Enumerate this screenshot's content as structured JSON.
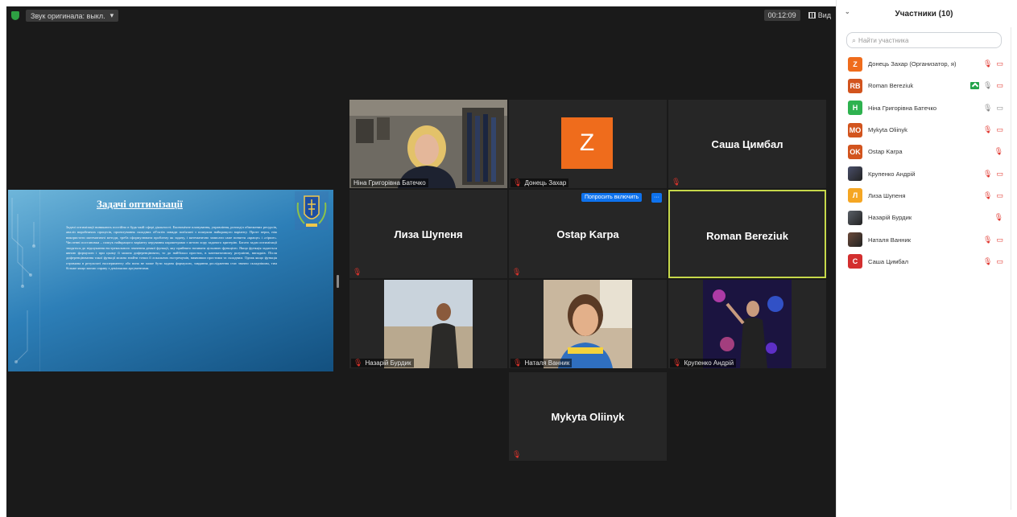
{
  "topbar": {
    "audio_label": "Звук оригинала: выкл.",
    "audio_caret": "▾",
    "timer": "00:12:09",
    "view_label": "Вид"
  },
  "share": {
    "title": "Задачі оптимізації",
    "body": "Задачі оптимізації виникають постійно в будь-якій сфері діяльності. Економічне планування, управління, розподіл обмежених ресурсів, аналіз виробничих процесів, проектування складних об'єктів завжди пов'язані з пошуком найкращого варіанту. Проте перш, ніж використати математичні методи, треба сформулювати проблему як задачу, і математично записати саме поняття «краще» і «гірше». Численні постановки – пошук найкращого варіанту керування параметрами з метою хору заданого критерію. Багато задач оптимізації зводяться до відшукання екстремального значення деякої функції, яку прийнято називати цільовою функцією. Якщо функція задається явною формулою і при цьому її можна диференціювати, то до найбільш простих, в математичному розумінні, випадків. Після диференціювання такої функції можна знайти точки її локальних екстремумів, виявивши простими та складним. Однак якщо функція отримана в результаті експерименту або вона не може бути задана формулою, завдання дослідження стає значно складнішим, тим більше якщо маємо справу з декількома аргументами."
  },
  "tiles": {
    "nina": "Ніна Григорівна Батечко",
    "donets_avatar": "Z",
    "donets": "Донець Захар",
    "sasha": "Саша Цимбал",
    "liza": "Лиза Шупеня",
    "ostap": "Ostap Karpa",
    "roman": "Roman Bereziuk",
    "nazariy": "Назарій Бурдик",
    "natalia": "Наталя Ванник",
    "krupenko": "Крупенко Андрій",
    "mykyta": "Mykyta Oliinyk",
    "ask_unmute": "Попросить включить",
    "more": "···"
  },
  "panel": {
    "title": "Участники (10)",
    "search_placeholder": "Найти участника",
    "participants": [
      {
        "initials": "Z",
        "color": "#ef6c1c",
        "name": "Донець Захар (Организатор, я)",
        "icons": "mic-off video-off"
      },
      {
        "initials": "RB",
        "color": "#d2541e",
        "name": "Roman Bereziuk",
        "icons": "share mic video-off"
      },
      {
        "initials": "H",
        "color": "#2eb24f",
        "name": "Ніна Григорівна Батечко",
        "icons": "mic-on video-on"
      },
      {
        "initials": "MO",
        "color": "#d2541e",
        "name": "Mykyta Oliinyk",
        "icons": "mic-off video-off"
      },
      {
        "initials": "OK",
        "color": "#d2541e",
        "name": "Ostap Karpa",
        "icons": "mic-off"
      },
      {
        "initials": "",
        "color": "#4a4f6a",
        "name": "Крупенко Андрій",
        "icons": "mic-off video-off"
      },
      {
        "initials": "Л",
        "color": "#f5a623",
        "name": "Лиза Шупеня",
        "icons": "mic-off video-off"
      },
      {
        "initials": "",
        "color": "#5a6068",
        "name": "Назарій Бурдик",
        "icons": "mic-off"
      },
      {
        "initials": "",
        "color": "#6b4a3a",
        "name": "Наталя Ванник",
        "icons": "mic-off video-off"
      },
      {
        "initials": "C",
        "color": "#d32f2f",
        "name": "Саша Цимбал",
        "icons": "mic-off video-off"
      }
    ]
  },
  "icons": {
    "mic_off": "🎙",
    "mic_on": "🎙",
    "video_off": "▭",
    "search": "⌕",
    "collapse": "⌄"
  }
}
